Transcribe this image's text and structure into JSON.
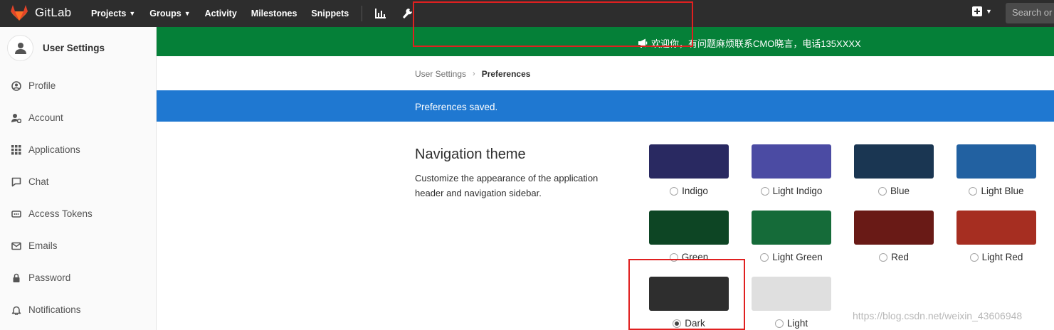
{
  "topbar": {
    "logo_text": "GitLab",
    "nav": [
      {
        "label": "Projects",
        "dropdown": true
      },
      {
        "label": "Groups",
        "dropdown": true
      },
      {
        "label": "Activity",
        "dropdown": false
      },
      {
        "label": "Milestones",
        "dropdown": false
      },
      {
        "label": "Snippets",
        "dropdown": false
      }
    ],
    "icons": [
      "chart-icon",
      "wrench-icon",
      "plus-icon",
      "chevron-down-icon"
    ],
    "search_placeholder": "Search or jump to..."
  },
  "sidebar": {
    "title": "User Settings",
    "items": [
      {
        "label": "Profile",
        "icon": "profile-icon"
      },
      {
        "label": "Account",
        "icon": "account-icon"
      },
      {
        "label": "Applications",
        "icon": "applications-icon"
      },
      {
        "label": "Chat",
        "icon": "chat-icon"
      },
      {
        "label": "Access Tokens",
        "icon": "access-tokens-icon"
      },
      {
        "label": "Emails",
        "icon": "email-icon"
      },
      {
        "label": "Password",
        "icon": "lock-icon"
      },
      {
        "label": "Notifications",
        "icon": "bell-icon"
      }
    ]
  },
  "banner": {
    "text": "欢迎你，有问题麻烦联系CMO晓言，电话135XXXX"
  },
  "breadcrumb": {
    "parent": "User Settings",
    "current": "Preferences"
  },
  "flash": {
    "text": "Preferences saved."
  },
  "navigation_theme": {
    "title": "Navigation theme",
    "description": "Customize the appearance of the application header and navigation sidebar.",
    "selected": "Dark",
    "themes": [
      {
        "label": "Indigo",
        "color": "#292961"
      },
      {
        "label": "Light Indigo",
        "color": "#4b4ba3"
      },
      {
        "label": "Blue",
        "color": "#1a3652"
      },
      {
        "label": "Light Blue",
        "color": "#2261a1"
      },
      {
        "label": "Green",
        "color": "#0d4524"
      },
      {
        "label": "Light Green",
        "color": "#156b39"
      },
      {
        "label": "Red",
        "color": "#691a16"
      },
      {
        "label": "Light Red",
        "color": "#a62e21"
      },
      {
        "label": "Dark",
        "color": "#2e2e2e"
      },
      {
        "label": "Light",
        "color": "#dfdfdf"
      }
    ]
  },
  "watermark": "https://blog.csdn.net/weixin_43606948",
  "colors": {
    "topbar": "#2d2d2d",
    "banner": "#058038",
    "flash": "#1f78d1",
    "annotation": "#e02020"
  }
}
